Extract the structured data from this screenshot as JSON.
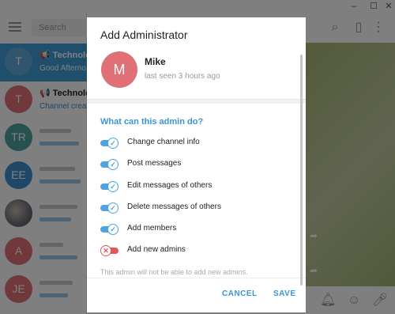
{
  "window": {
    "minimize_icon": "minimize-icon",
    "maximize_icon": "maximize-icon",
    "close_icon": "close-icon"
  },
  "sidebar": {
    "search_placeholder": "Search",
    "chats": [
      {
        "initials": "T",
        "name": "Technolo...",
        "subtitle": "Good Afterno...",
        "color": "#65aadd",
        "active": true
      },
      {
        "initials": "T",
        "name": "Technolo...",
        "subtitle": "Channel creat...",
        "color": "#e17076",
        "active": false
      },
      {
        "initials": "TR",
        "color": "#4fa39f"
      },
      {
        "initials": "EE",
        "color": "#3e90d1"
      },
      {
        "initials": "",
        "color": "#556070"
      },
      {
        "initials": "A",
        "color": "#e17076"
      },
      {
        "initials": "JE",
        "color": "#e17076"
      }
    ]
  },
  "dialog": {
    "title": "Add Administrator",
    "user": {
      "initial": "M",
      "name": "Mike",
      "status": "last seen 3 hours ago",
      "avatar_color": "#e17076"
    },
    "section_title": "What can this admin do?",
    "permissions": [
      {
        "label": "Change channel info",
        "enabled": true
      },
      {
        "label": "Post messages",
        "enabled": true
      },
      {
        "label": "Edit messages of others",
        "enabled": true
      },
      {
        "label": "Delete messages of others",
        "enabled": true
      },
      {
        "label": "Add members",
        "enabled": true
      },
      {
        "label": "Add new admins",
        "enabled": false
      }
    ],
    "note": "This admin will not be able to add new admins.",
    "cancel_label": "CANCEL",
    "save_label": "SAVE"
  },
  "colors": {
    "accent": "#3a95d5",
    "toggle_on": "#4ea4e0",
    "toggle_off": "#e45757"
  }
}
